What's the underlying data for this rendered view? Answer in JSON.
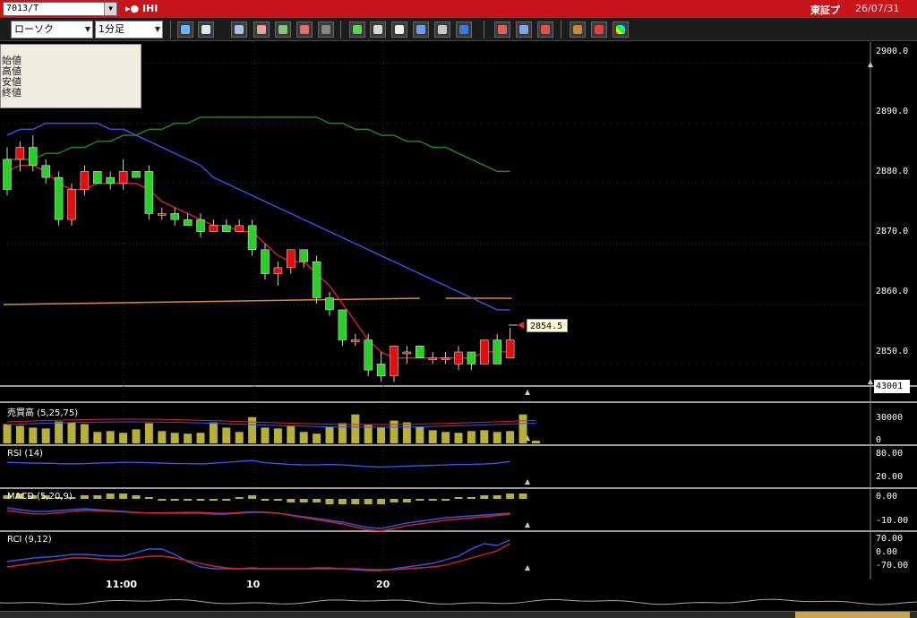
{
  "title_bar": {
    "symbol": "7013/T",
    "name": "IHI",
    "exchange": "東証プ",
    "date": "26/07/31"
  },
  "toolbar": {
    "chart_type": "ローソク",
    "timeframe": "1分足"
  },
  "info_box": {
    "rows": [
      "始値",
      "高値",
      "安値",
      "終値"
    ]
  },
  "price_axis": {
    "labels": [
      "2900.0",
      "2890.0",
      "2880.0",
      "2870.0",
      "2860.0",
      "2850.0"
    ],
    "values": [
      2900,
      2890,
      2880,
      2870,
      2860,
      2850
    ]
  },
  "current_price": "2854.5",
  "volume_current": "43001",
  "volume_axis": [
    "30000",
    "0"
  ],
  "rsi_axis": [
    "80.00",
    "20.00"
  ],
  "macd_axis": [
    "0.00",
    "-10.00"
  ],
  "rci_axis": [
    "70.00",
    "0.00",
    "-70.00"
  ],
  "panels": {
    "volume": "売買高 (5,25,75)",
    "rsi": "RSI (14)",
    "macd": "MACD (5,20,9)",
    "rci": "RCI (9,12)"
  },
  "time_labels": [
    "11:00",
    "10",
    "20"
  ],
  "colors": {
    "title_bar": "#c8141b",
    "up_candle": "#e01010",
    "down_candle": "#28d028",
    "ma_short": "#e02020",
    "ma_mid": "#3355ee",
    "ma_long": "#208a20",
    "ma_orange": "#e08a20",
    "volume_bar": "#b7b03a"
  },
  "chart_data": {
    "type": "candlestick",
    "ylim": [
      2845,
      2902
    ],
    "candles": [
      {
        "o": 2884,
        "h": 2886,
        "l": 2878,
        "c": 2879
      },
      {
        "o": 2884,
        "h": 2887,
        "l": 2882,
        "c": 2886
      },
      {
        "o": 2886,
        "h": 2888,
        "l": 2882,
        "c": 2883
      },
      {
        "o": 2883,
        "h": 2884,
        "l": 2880,
        "c": 2881
      },
      {
        "o": 2881,
        "h": 2882,
        "l": 2873,
        "c": 2874
      },
      {
        "o": 2874,
        "h": 2880,
        "l": 2873,
        "c": 2879
      },
      {
        "o": 2879,
        "h": 2883,
        "l": 2878,
        "c": 2882
      },
      {
        "o": 2882,
        "h": 2882,
        "l": 2880,
        "c": 2880
      },
      {
        "o": 2881,
        "h": 2882,
        "l": 2879,
        "c": 2880
      },
      {
        "o": 2880,
        "h": 2884,
        "l": 2879,
        "c": 2882
      },
      {
        "o": 2882,
        "h": 2882,
        "l": 2881,
        "c": 2881
      },
      {
        "o": 2882,
        "h": 2883,
        "l": 2874,
        "c": 2875
      },
      {
        "o": 2875,
        "h": 2876,
        "l": 2874,
        "c": 2875
      },
      {
        "o": 2875,
        "h": 2876,
        "l": 2873,
        "c": 2874
      },
      {
        "o": 2874,
        "h": 2875,
        "l": 2873,
        "c": 2873
      },
      {
        "o": 2874,
        "h": 2875,
        "l": 2871,
        "c": 2872
      },
      {
        "o": 2872,
        "h": 2874,
        "l": 2872,
        "c": 2873
      },
      {
        "o": 2873,
        "h": 2874,
        "l": 2872,
        "c": 2872
      },
      {
        "o": 2872,
        "h": 2874,
        "l": 2872,
        "c": 2873
      },
      {
        "o": 2873,
        "h": 2874,
        "l": 2868,
        "c": 2869
      },
      {
        "o": 2869,
        "h": 2870,
        "l": 2864,
        "c": 2865
      },
      {
        "o": 2865,
        "h": 2867,
        "l": 2863,
        "c": 2866
      },
      {
        "o": 2866,
        "h": 2869,
        "l": 2865,
        "c": 2869
      },
      {
        "o": 2869,
        "h": 2869,
        "l": 2866,
        "c": 2867
      },
      {
        "o": 2867,
        "h": 2868,
        "l": 2860,
        "c": 2861
      },
      {
        "o": 2861,
        "h": 2862,
        "l": 2858,
        "c": 2859
      },
      {
        "o": 2859,
        "h": 2859,
        "l": 2853,
        "c": 2854
      },
      {
        "o": 2854,
        "h": 2855,
        "l": 2853,
        "c": 2854
      },
      {
        "o": 2854,
        "h": 2855,
        "l": 2848,
        "c": 2849
      },
      {
        "o": 2850,
        "h": 2852,
        "l": 2847,
        "c": 2848
      },
      {
        "o": 2848,
        "h": 2853,
        "l": 2847,
        "c": 2853
      },
      {
        "o": 2852,
        "h": 2853,
        "l": 2850,
        "c": 2852
      },
      {
        "o": 2853,
        "h": 2853,
        "l": 2851,
        "c": 2851
      },
      {
        "o": 2851,
        "h": 2852,
        "l": 2850,
        "c": 2851
      },
      {
        "o": 2851,
        "h": 2852,
        "l": 2850,
        "c": 2851
      },
      {
        "o": 2850,
        "h": 2853,
        "l": 2849,
        "c": 2852
      },
      {
        "o": 2852,
        "h": 2852,
        "l": 2849,
        "c": 2850
      },
      {
        "o": 2850,
        "h": 2854,
        "l": 2850,
        "c": 2854
      },
      {
        "o": 2854,
        "h": 2855,
        "l": 2850,
        "c": 2850
      },
      {
        "o": 2851,
        "h": 2856,
        "l": 2851,
        "c": 2854
      }
    ],
    "ma_short": [
      2882,
      2883,
      2883,
      2882,
      2880,
      2879,
      2879,
      2880,
      2880,
      2880,
      2880,
      2879,
      2877,
      2876,
      2875,
      2874,
      2873,
      2873,
      2872,
      2872,
      2870,
      2868,
      2867,
      2867,
      2865,
      2863,
      2860,
      2857,
      2854,
      2852,
      2851,
      2851,
      2851,
      2851,
      2851,
      2851,
      2851,
      2852,
      2852,
      2852
    ],
    "ma_mid": [
      2888,
      2889,
      2889,
      2890,
      2890,
      2890,
      2890,
      2890,
      2889,
      2889,
      2888,
      2887,
      2886,
      2885,
      2884,
      2883,
      2881,
      2880,
      2879,
      2878,
      2877,
      2876,
      2875,
      2874,
      2873,
      2872,
      2871,
      2870,
      2869,
      2868,
      2867,
      2866,
      2865,
      2864,
      2863,
      2862,
      2861,
      2860,
      2859,
      2859
    ],
    "ma_long": [
      2884,
      2884,
      2884,
      2885,
      2885,
      2886,
      2886,
      2887,
      2887,
      2888,
      2888,
      2889,
      2889,
      2890,
      2890,
      2891,
      2891,
      2891,
      2891,
      2891,
      2891,
      2891,
      2891,
      2891,
      2891,
      2890,
      2890,
      2889,
      2889,
      2888,
      2888,
      2887,
      2887,
      2886,
      2886,
      2885,
      2884,
      2883,
      2882,
      2882
    ],
    "volume": [
      22000,
      20000,
      18000,
      17000,
      25000,
      24000,
      22000,
      13000,
      14000,
      12000,
      16000,
      23000,
      14000,
      12000,
      11000,
      12000,
      24000,
      18000,
      13000,
      30000,
      18000,
      17000,
      20000,
      13000,
      11000,
      19000,
      23000,
      33000,
      21000,
      18000,
      26000,
      24000,
      19000,
      15000,
      13000,
      12000,
      14000,
      15000,
      13000,
      14000,
      33000,
      3000
    ],
    "volume_max": 45000
  }
}
